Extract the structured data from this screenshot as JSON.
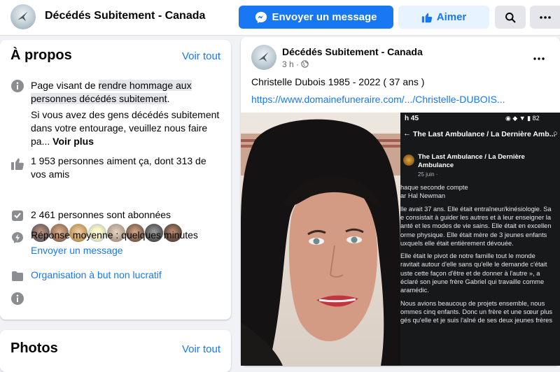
{
  "header": {
    "page_name": "Décédés Subitement - Canada",
    "message_button": "Envoyer un message",
    "like_button": "Aimer"
  },
  "about": {
    "title": "À propos",
    "see_all": "Voir tout",
    "description_pre": "Page visant de ",
    "description_highlight": "rendre hommage aux personnes décédés subitement",
    "description_post": ".",
    "invite_text": "Si vous avez des gens décédés subitement dans votre entourage, veuillez nous faire pa...",
    "see_more": "Voir plus",
    "likes_text": "1 953 personnes aiment ça, dont 313 de vos amis",
    "followers_text": "2 461 personnes sont abonnées",
    "response_text": "Réponse moyenne : quelques minutes",
    "send_message_link": "Envoyer un message",
    "category": "Organisation à but non lucratif"
  },
  "photos": {
    "title": "Photos",
    "see_all": "Voir tout"
  },
  "post": {
    "author": "Décédés Subitement - Canada",
    "time": "3 h ·",
    "text": "Christelle Dubois 1985 - 2022 ( 37 ans )",
    "link": "https://www.domainefuneraire.com/.../Christelle-DUBOIS...",
    "screenshot": {
      "status_time": "h 45",
      "header_title": "The Last Ambulance / La Dernière Amb...",
      "page_name_line1": "The Last Ambulance / La Dernière",
      "page_name_line2": "Ambulance",
      "date": "25 juin · ",
      "lines": [
        "haque seconde compte",
        "ar Hal Newman",
        "",
        "lle avait 37 ans. Elle était entraîneur/kinésiologie. Sa",
        "e consistait à guider les autres et à leur enseigner la",
        "anté et les modes de vie sains. Elle était en excellen",
        "orme physique. Elle était mère de 3 jeunes enfants",
        "uxquels elle était entièrement dévouée.",
        "",
        "Elle était le pivot de notre famille tout le monde",
        "ravitait autour d'elle sans qu'elle le demande c'était",
        "uste cette façon d'être et de donner à l'autre », a",
        "éclaré son jeune frère Gabriel qui travaille comme",
        "aramédic.",
        "",
        "Nous avions beaucoup de projets ensemble, nous",
        "ommes cinq enfants. Donc un frère et une sœur plus",
        "gés qu'elle et je suis l'aîné de ses deux jeunes frères"
      ]
    }
  },
  "colors": {
    "accent": "#1877f2",
    "accent_light": "#e7f3ff",
    "background": "#f0f2f5"
  },
  "icons": [
    "messenger-icon",
    "thumbs-up-icon",
    "search-icon",
    "more-icon",
    "info-icon",
    "like-icon",
    "followers-icon",
    "response-icon",
    "category-icon",
    "globe-icon"
  ]
}
